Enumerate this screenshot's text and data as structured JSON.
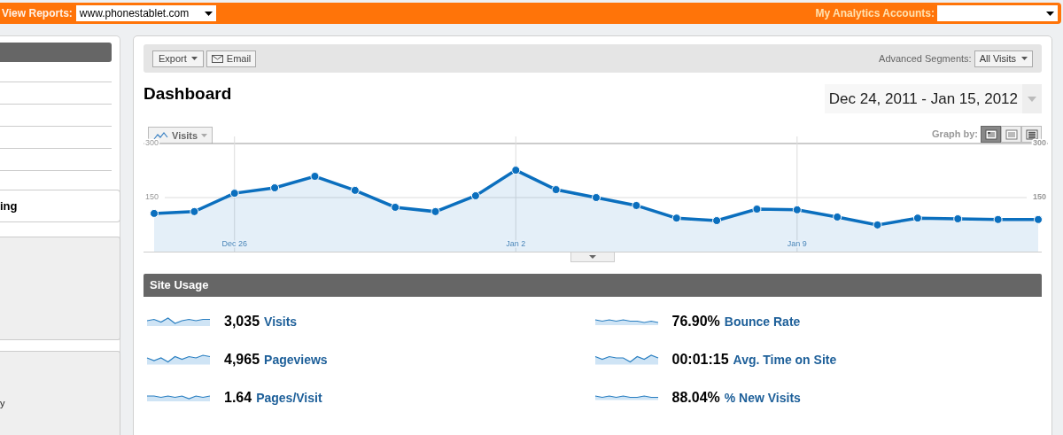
{
  "top_bar": {
    "view_reports": {
      "label": "View Reports:",
      "value": "www.phonestablet.com"
    },
    "accounts": {
      "label": "My Analytics Accounts:"
    }
  },
  "sidebar": {
    "fragments": [
      {
        "kind": "heading",
        "text": "ing"
      },
      {
        "kind": "plain",
        "text": "y"
      }
    ]
  },
  "toolbar": {
    "export": "Export",
    "email": "Email",
    "segments_label": "Advanced Segments:",
    "segments_value": "All Visits"
  },
  "title": "Dashboard",
  "date_range": "Dec 24, 2011 - Jan 15, 2012",
  "graph": {
    "graph_by_label": "Graph by:",
    "graph_by": [
      {
        "kind": "day",
        "selected": true
      },
      {
        "kind": "week",
        "selected": false
      },
      {
        "kind": "month",
        "selected": false
      }
    ],
    "right_axis_labels": [
      "300",
      "150"
    ],
    "chart_data": {
      "type": "area",
      "categories": [
        null,
        null,
        "Dec 26",
        null,
        null,
        null,
        null,
        null,
        null,
        "Jan 2",
        null,
        null,
        null,
        null,
        null,
        null,
        "Jan 9",
        null,
        null,
        null,
        null,
        null,
        null
      ],
      "series": [
        {
          "name": "Visits",
          "color": "#0b6fbe",
          "values": [
            106,
            111,
            162,
            177,
            209,
            170,
            123,
            111,
            155,
            226,
            172,
            150,
            128,
            93,
            86,
            118,
            116,
            96,
            74,
            93,
            91,
            89,
            89
          ]
        }
      ],
      "ylim": [
        0,
        300
      ],
      "yticks": [
        150,
        300
      ],
      "grid": true
    }
  },
  "site_usage": {
    "title": "Site Usage",
    "metrics": [
      {
        "value": "3,035",
        "label": "Visits"
      },
      {
        "value": "76.90%",
        "label": "Bounce Rate"
      },
      {
        "value": "4,965",
        "label": "Pageviews"
      },
      {
        "value": "00:01:15",
        "label": "Avg. Time on Site"
      },
      {
        "value": "1.64",
        "label": "Pages/Visit"
      },
      {
        "value": "88.04%",
        "label": "% New Visits"
      }
    ]
  }
}
